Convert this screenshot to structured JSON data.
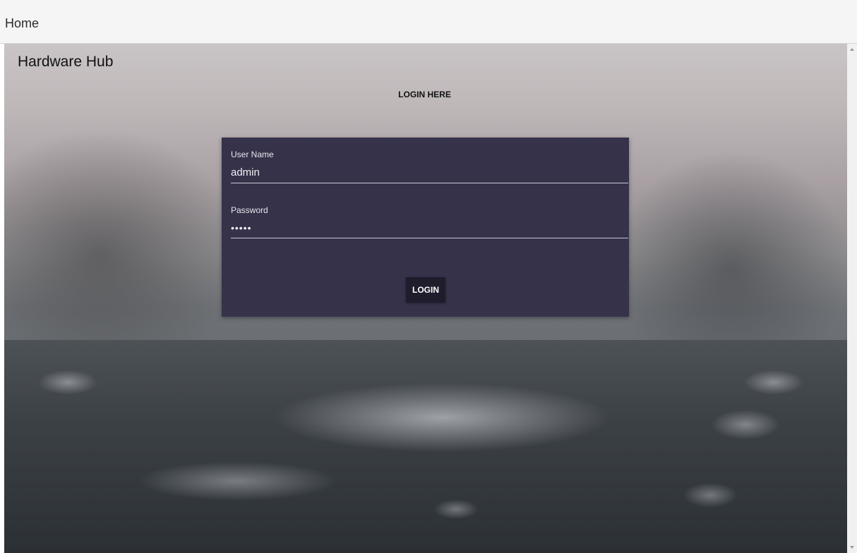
{
  "header": {
    "home_link": "Home"
  },
  "brand": "Hardware Hub",
  "login": {
    "heading": "LOGIN HERE",
    "username": {
      "label": "User Name",
      "value": "admin"
    },
    "password": {
      "label": "Password",
      "value": "•••••"
    },
    "submit_label": "LOGIN"
  },
  "colors": {
    "panel": "#35324a",
    "button": "#1f1c2c",
    "topbar": "#f5f5f5"
  }
}
